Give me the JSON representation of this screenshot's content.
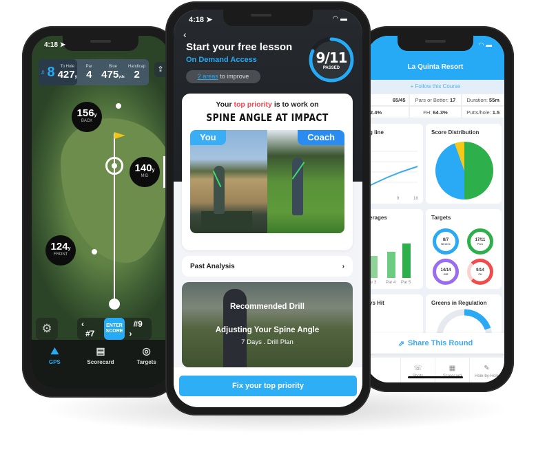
{
  "left_phone": {
    "time": "4:18",
    "hole": {
      "label": "#",
      "number": "8"
    },
    "stats": [
      {
        "label": "To Hole",
        "value": "427",
        "unit": "y"
      },
      {
        "label": "Par",
        "value": "4",
        "unit": ""
      },
      {
        "label": "Blue",
        "value": "475",
        "unit": "yds"
      },
      {
        "label": "Handicap",
        "value": "2",
        "unit": ""
      }
    ],
    "yardages": {
      "back": {
        "value": "156",
        "unit": "y",
        "label": "BACK"
      },
      "mid": {
        "value": "140",
        "unit": "y",
        "label": "MID"
      },
      "front": {
        "value": "124",
        "unit": "y",
        "label": "FRONT"
      }
    },
    "score_nav": {
      "prev": "#7",
      "enter": "ENTER SCORE",
      "next": "#9"
    },
    "tabs": [
      {
        "label": "GPS",
        "icon": "map-pin-icon",
        "active": true
      },
      {
        "label": "Scorecard",
        "icon": "scorecard-icon",
        "active": false
      },
      {
        "label": "Targets",
        "icon": "target-icon",
        "active": false
      }
    ]
  },
  "middle_phone": {
    "time": "4:18",
    "title": "Start your free lesson",
    "subtitle": "On Demand Access",
    "areas_link": "2 areas",
    "areas_text": "to improve",
    "progress": {
      "value": "9/11",
      "label": "PASSED",
      "fraction": 0.82
    },
    "priority": {
      "prefix": "Your",
      "highlight": "top priority",
      "suffix": "is to work on",
      "title": "SPINE ANGLE AT IMPACT",
      "you_label": "You",
      "coach_label": "Coach"
    },
    "past_analysis": "Past Analysis",
    "drill": {
      "heading": "Recommended Drill",
      "name": "Adjusting Your Spine Angle",
      "meta": "7 Days  .  Drill Plan"
    },
    "cta": "Fix your top priority",
    "colors": {
      "accent": "#27aaf5",
      "highlight": "#f4474e"
    }
  },
  "right_phone": {
    "course": "La Quinta Resort",
    "follow": "+ Follow this Course",
    "stats": [
      {
        "label": "",
        "value": "65/45"
      },
      {
        "label": "Pars or Better:",
        "value": "17"
      },
      {
        "label": "Duration:",
        "value": "55m"
      },
      {
        "label": "",
        "value": "2.4%"
      },
      {
        "label": "FH:",
        "value": "64.3%"
      },
      {
        "label": "Putts/hole:",
        "value": "1.5"
      }
    ],
    "cards": {
      "scoring_line": {
        "title": "g line",
        "ticks": [
          "9",
          "18"
        ]
      },
      "score_distribution": {
        "title": "Score Distribution"
      },
      "averages": {
        "title": "erages",
        "ticks": [
          "ar 3",
          "Par 4",
          "Par 5"
        ]
      },
      "targets": {
        "title": "Targets",
        "rings": [
          {
            "value": "8/7",
            "label": "Birdies",
            "color": "#2aa9f4"
          },
          {
            "value": "17/11",
            "label": "Pars",
            "color": "#2db04b"
          },
          {
            "value": "14/14",
            "label": "GIR",
            "color": "#9a6cf0"
          },
          {
            "value": "9/14",
            "label": "FH",
            "color": "#f24b4b"
          }
        ]
      },
      "fairways": {
        "title": "ys Hit"
      },
      "gir": {
        "title": "Greens in Regulation"
      }
    },
    "share": "Share This Round",
    "tabs": [
      {
        "label": "",
        "icon": "blank"
      },
      {
        "label": "Shots",
        "icon": "shots-icon"
      },
      {
        "label": "Scorecard",
        "icon": "scorecard-icon"
      },
      {
        "label": "Hole-by-Hole",
        "icon": "pencil-icon"
      }
    ]
  }
}
